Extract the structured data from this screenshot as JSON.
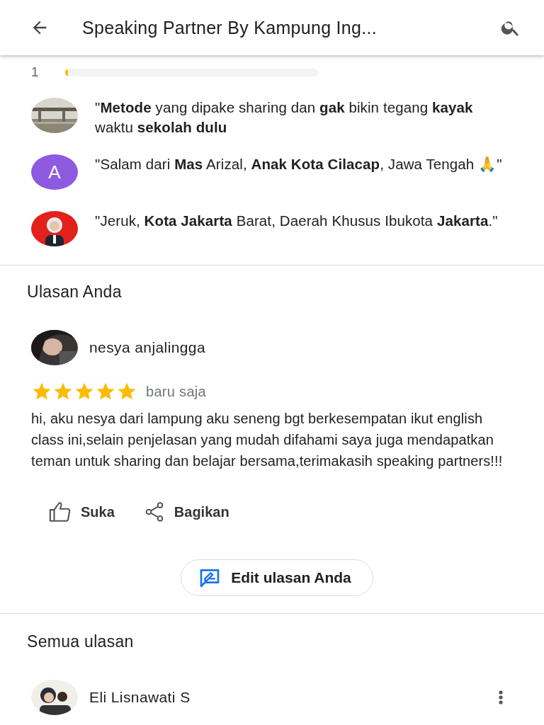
{
  "app_bar": {
    "title": "Speaking Partner By Kampung Ing..."
  },
  "rating_bar": {
    "label": "1",
    "level": 0.012
  },
  "highlights": [
    {
      "kind": "picture",
      "text": "\"**Metode** yang dipake sharing dan **gak** bikin tegang **kayak** waktu **sekolah dulu**"
    },
    {
      "kind": "letter",
      "letter": "A",
      "color": "#8e5ae0",
      "text": "\"Salam dari **Mas** Arizal, **Anak Kota Cilacap**, Jawa Tengah 🙏\""
    },
    {
      "kind": "picture",
      "text": "\"Jeruk, **Kota Jakarta** Barat, Daerah Khusus Ibukota **Jakarta**.\""
    }
  ],
  "your_review": {
    "heading": "Ulasan Anda",
    "author": "nesya anjalingga",
    "stars": 5,
    "time": "baru saja",
    "text": "hi, aku nesya dari lampung aku seneng bgt berkesempatan ikut english class ini,selain penjelasan yang mudah difahami saya juga mendapatkan teman untuk sharing dan belajar bersama,terimakasih speaking partners!!!",
    "actions": [
      {
        "kind": "like",
        "label": "Suka"
      },
      {
        "kind": "share",
        "label": "Bagikan"
      }
    ],
    "edit_button": "Edit ulasan Anda"
  },
  "all_reviews": {
    "heading": "Semua ulasan",
    "reviews": [
      {
        "author": "Eli Lisnawati S"
      }
    ]
  }
}
